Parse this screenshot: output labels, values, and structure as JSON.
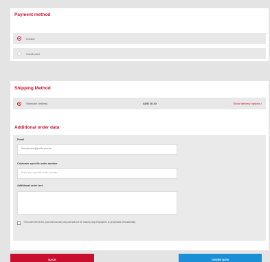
{
  "payment": {
    "title": "Payment method",
    "options": [
      {
        "label": "Invoice",
        "selected": true
      },
      {
        "label": "Credit card",
        "selected": false
      }
    ]
  },
  "shipping": {
    "title": "Shipping Method",
    "method": "Standard delivery",
    "price": "AUD 10.10",
    "change_link": "Show delivery options  ›"
  },
  "additional": {
    "title": "Additional order data",
    "email_label": "Email",
    "email_value": "Sara.jensen@proffs.com.au",
    "order_number_label": "Customer specific order number",
    "order_number_placeholder": "Enter your specific order number",
    "note_label": "Additional order text",
    "note_value": "",
    "disclaimer": "This order text is for your internal use only and will not be read by any employees or processed mechanically."
  },
  "buttons": {
    "back_label": "BACK",
    "order_label": "ORDER NOW",
    "back_color": "#c8102e",
    "order_color": "#1a8fd6"
  },
  "colors": {
    "accent": "#c8102e",
    "background": "#e4e4e4"
  }
}
